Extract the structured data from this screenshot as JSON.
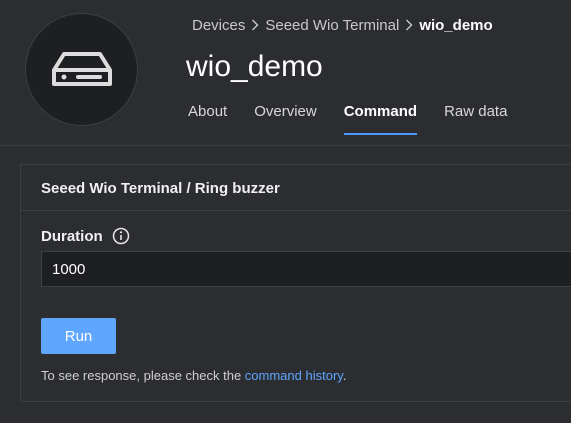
{
  "breadcrumb": {
    "items": [
      "Devices",
      "Seeed Wio Terminal"
    ],
    "current": "wio_demo"
  },
  "device": {
    "title": "wio_demo",
    "icon": "device-icon"
  },
  "tabs": [
    {
      "label": "About",
      "active": false
    },
    {
      "label": "Overview",
      "active": false
    },
    {
      "label": "Command",
      "active": true
    },
    {
      "label": "Raw data",
      "active": false
    }
  ],
  "command": {
    "title": "Seeed Wio Terminal / Ring buzzer",
    "field_label": "Duration",
    "field_value": "1000",
    "run_label": "Run",
    "hint_prefix": "To see response, please check the ",
    "hint_link": "command history",
    "hint_suffix": "."
  },
  "colors": {
    "accent": "#4d95ff",
    "button": "#5ea6ff",
    "panel": "#2b2d31"
  }
}
